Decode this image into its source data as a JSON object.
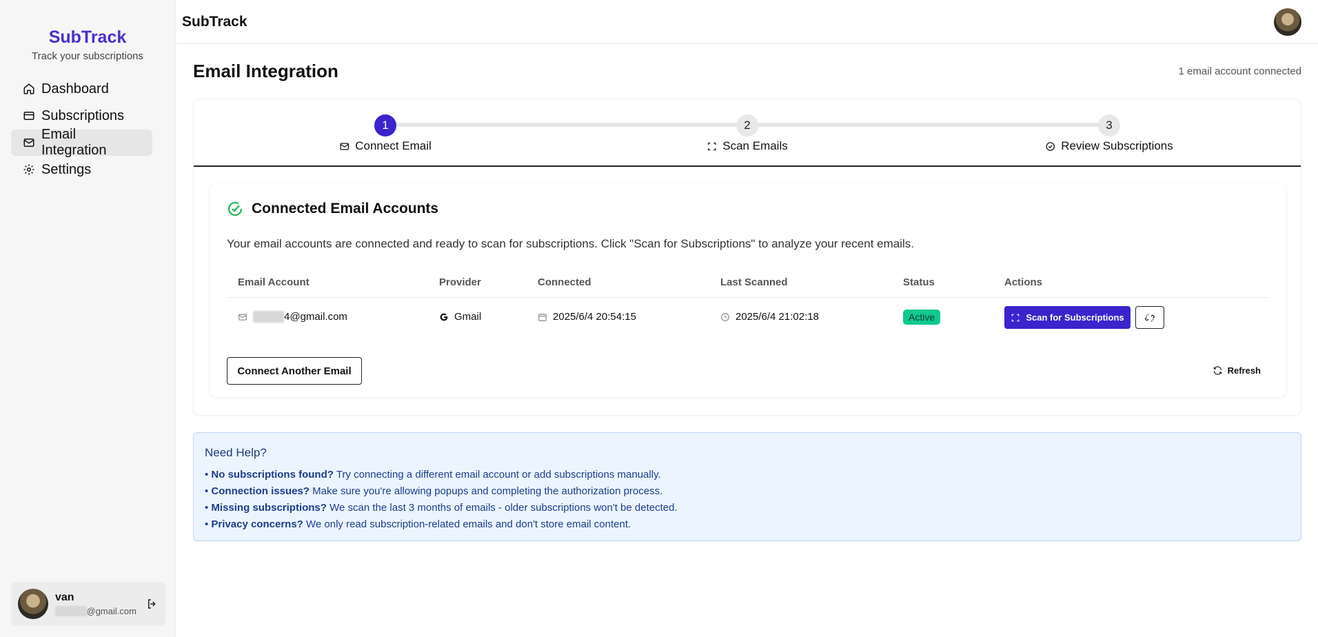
{
  "sidebar": {
    "brand": "SubTrack",
    "tagline": "Track your subscriptions",
    "items": [
      {
        "label": "Dashboard",
        "icon": "home-icon"
      },
      {
        "label": "Subscriptions",
        "icon": "card-icon"
      },
      {
        "label": "Email Integration",
        "icon": "mail-icon"
      },
      {
        "label": "Settings",
        "icon": "gear-icon"
      }
    ],
    "user": {
      "name": "van",
      "email_suffix": "@gmail.com"
    }
  },
  "topbar": {
    "title": "SubTrack"
  },
  "page": {
    "title": "Email Integration",
    "meta": "1 email account connected"
  },
  "steps": [
    {
      "num": "1",
      "label": "Connect Email",
      "icon": "mail-icon",
      "active": true
    },
    {
      "num": "2",
      "label": "Scan Emails",
      "icon": "scan-icon",
      "active": false
    },
    {
      "num": "3",
      "label": "Review Subscriptions",
      "icon": "check-circle-icon",
      "active": false
    }
  ],
  "accounts": {
    "title": "Connected Email Accounts",
    "description": "Your email accounts are connected and ready to scan for subscriptions. Click \"Scan for Subscriptions\" to analyze your recent emails.",
    "columns": [
      "Email Account",
      "Provider",
      "Connected",
      "Last Scanned",
      "Status",
      "Actions"
    ],
    "rows": [
      {
        "email_suffix": "4@gmail.com",
        "provider": "Gmail",
        "connected": "2025/6/4 20:54:15",
        "last_scanned": "2025/6/4 21:02:18",
        "status": "Active",
        "action_label": "Scan for Subscriptions"
      }
    ],
    "connect_another": "Connect Another Email",
    "refresh": "Refresh"
  },
  "help": {
    "title": "Need Help?",
    "items": [
      {
        "bold": "No subscriptions found?",
        "text": " Try connecting a different email account or add subscriptions manually."
      },
      {
        "bold": "Connection issues?",
        "text": " Make sure you're allowing popups and completing the authorization process."
      },
      {
        "bold": "Missing subscriptions?",
        "text": " We scan the last 3 months of emails - older subscriptions won't be detected."
      },
      {
        "bold": "Privacy concerns?",
        "text": " We only read subscription-related emails and don't store email content."
      }
    ]
  },
  "colors": {
    "brand": "#4a2fd1",
    "primary": "#3b24cc",
    "success": "#10c98f",
    "help_bg": "#ecf4ff"
  }
}
